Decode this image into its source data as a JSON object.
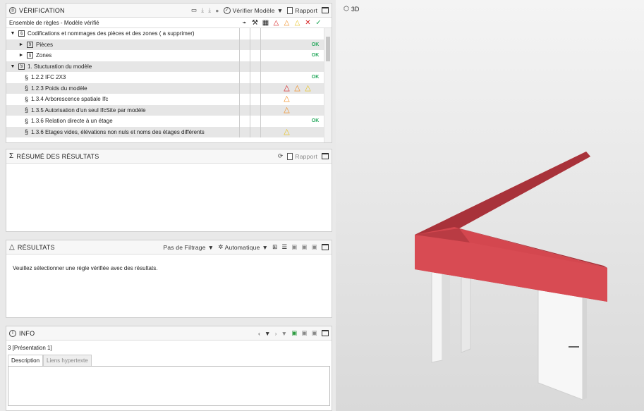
{
  "verification": {
    "title": "VÉRIFICATION",
    "verify_label": "Vérifier Modèle",
    "report_label": "Rapport",
    "ruleset_label": "Ensemble de règles - Modèle vérifié",
    "ok_label": "OK",
    "rows": [
      {
        "level": 0,
        "icon": "folder",
        "label": "Codifications et nommages des pièces et des zones ( a supprimer)",
        "status": []
      },
      {
        "level": 1,
        "icon": "folder",
        "label": "Pièces",
        "status": [
          "ok"
        ]
      },
      {
        "level": 1,
        "icon": "folder",
        "label": "Zones",
        "status": [
          "ok"
        ]
      },
      {
        "level": 0,
        "icon": "folder",
        "label": "1. Stucturation du modèle",
        "status": []
      },
      {
        "level": 2,
        "icon": "rule",
        "label": "1.2.2 IFC 2X3",
        "status": [
          "ok"
        ]
      },
      {
        "level": 2,
        "icon": "rule",
        "label": "1.2.3 Poids du modèle",
        "status": [
          "red",
          "orange",
          "yellow"
        ]
      },
      {
        "level": 2,
        "icon": "rule",
        "label": "1.3.4 Arborescence spatiale Ifc",
        "status": [
          "orange"
        ]
      },
      {
        "level": 2,
        "icon": "rule",
        "label": "1.3.5 Autorisation d'un seul IfcSite par modèle",
        "status": [
          "orange"
        ]
      },
      {
        "level": 2,
        "icon": "rule",
        "label": "1.3.6 Relation directe à un étage",
        "status": [
          "ok"
        ]
      },
      {
        "level": 2,
        "icon": "rule",
        "label": "1.3.6 Etages vides, élévations non nuls et noms des étages différents",
        "status": [
          "yellow"
        ]
      }
    ]
  },
  "resume": {
    "title": "RÉSUMÉ DES RÉSULTATS",
    "report_label": "Rapport"
  },
  "results": {
    "title": "RÉSULTATS",
    "filter_label": "Pas de Filtrage",
    "auto_label": "Automatique",
    "message": "Veuillez sélectionner une règle vérifiée avec des résultats."
  },
  "info": {
    "title": "INFO",
    "presentation": "3 [Présentation 1]",
    "tab_description": "Description",
    "tab_links": "Liens hypertexte"
  },
  "viewer": {
    "tab_label": "3D"
  },
  "colors": {
    "beam": "#d4474f",
    "beam_top": "#a8323a",
    "red": "#d62020",
    "orange": "#f08a1c",
    "yellow": "#e8c21e",
    "ok": "#25a85c"
  }
}
